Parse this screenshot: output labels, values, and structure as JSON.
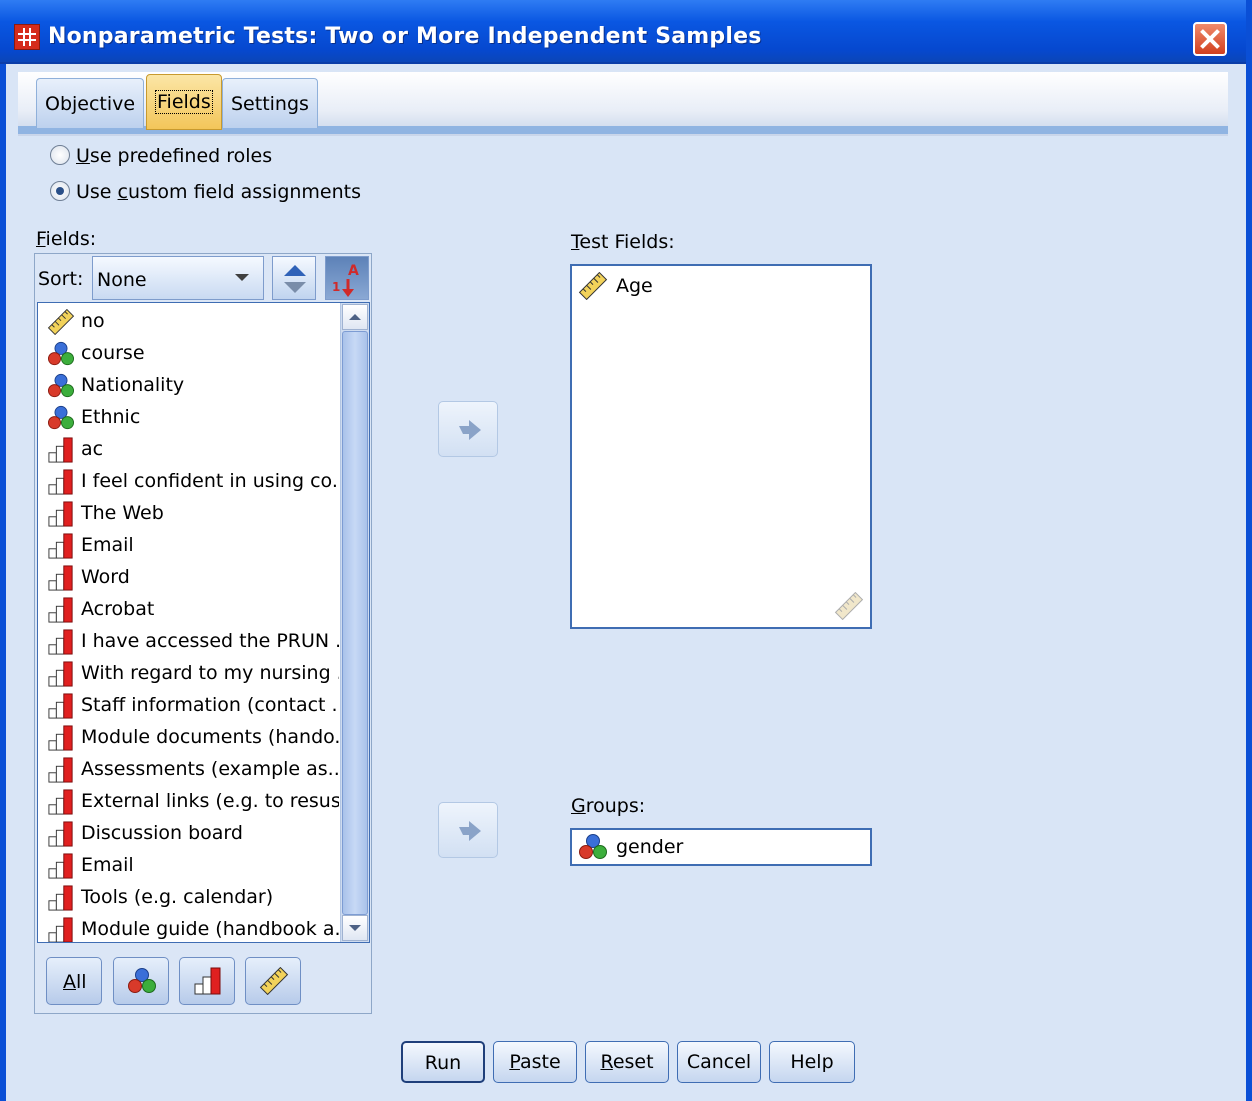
{
  "window": {
    "title": "Nonparametric Tests: Two or More Independent Samples"
  },
  "tabs": [
    {
      "label": "Objective",
      "active": false
    },
    {
      "label": "Fields",
      "active": true
    },
    {
      "label": "Settings",
      "active": false
    }
  ],
  "roles": {
    "predefined_label": "Use predefined roles",
    "predefined_u": "U",
    "predefined_rest": "se predefined roles",
    "custom_pre": "Use ",
    "custom_u": "c",
    "custom_rest": "ustom field assignments",
    "selected": "custom"
  },
  "fields_panel": {
    "label_u": "F",
    "label_rest": "ields:",
    "sort_label": "Sort:",
    "sort_value": "None",
    "items": [
      {
        "name": "no",
        "icon": "scale-ruler-icon"
      },
      {
        "name": "course",
        "icon": "nominal-icon"
      },
      {
        "name": "Nationality",
        "icon": "nominal-icon"
      },
      {
        "name": "Ethnic",
        "icon": "nominal-icon"
      },
      {
        "name": "ac",
        "icon": "ordinal-icon"
      },
      {
        "name": "I feel confident in using co...",
        "icon": "ordinal-icon"
      },
      {
        "name": "The Web",
        "icon": "ordinal-icon"
      },
      {
        "name": "Email",
        "icon": "ordinal-icon"
      },
      {
        "name": "Word",
        "icon": "ordinal-icon"
      },
      {
        "name": "Acrobat",
        "icon": "ordinal-icon"
      },
      {
        "name": "I have accessed the PRUN ...",
        "icon": "ordinal-icon"
      },
      {
        "name": "With regard to my nursing ...",
        "icon": "ordinal-icon"
      },
      {
        "name": "Staff information (contact ...",
        "icon": "ordinal-icon"
      },
      {
        "name": "Module documents (hando...",
        "icon": "ordinal-icon"
      },
      {
        "name": "Assessments (example as...",
        "icon": "ordinal-icon"
      },
      {
        "name": "External links (e.g. to resus...",
        "icon": "ordinal-icon"
      },
      {
        "name": "Discussion board",
        "icon": "ordinal-icon"
      },
      {
        "name": "Email",
        "icon": "ordinal-icon"
      },
      {
        "name": "Tools (e.g. calendar)",
        "icon": "ordinal-icon"
      },
      {
        "name": "Module guide (handbook a...",
        "icon": "ordinal-icon"
      }
    ],
    "filter_all_u": "A",
    "filter_all_rest": "ll"
  },
  "test_fields": {
    "label_u": "T",
    "label_rest": "est Fields:",
    "items": [
      {
        "name": "Age",
        "icon": "scale-ruler-icon"
      }
    ]
  },
  "groups": {
    "label_u": "G",
    "label_rest": "roups:",
    "value": "gender",
    "icon": "nominal-icon"
  },
  "buttons": {
    "run": "Run",
    "paste_u": "P",
    "paste_rest": "aste",
    "reset_u": "R",
    "reset_rest": "eset",
    "cancel": "Cancel",
    "help": "Help"
  }
}
